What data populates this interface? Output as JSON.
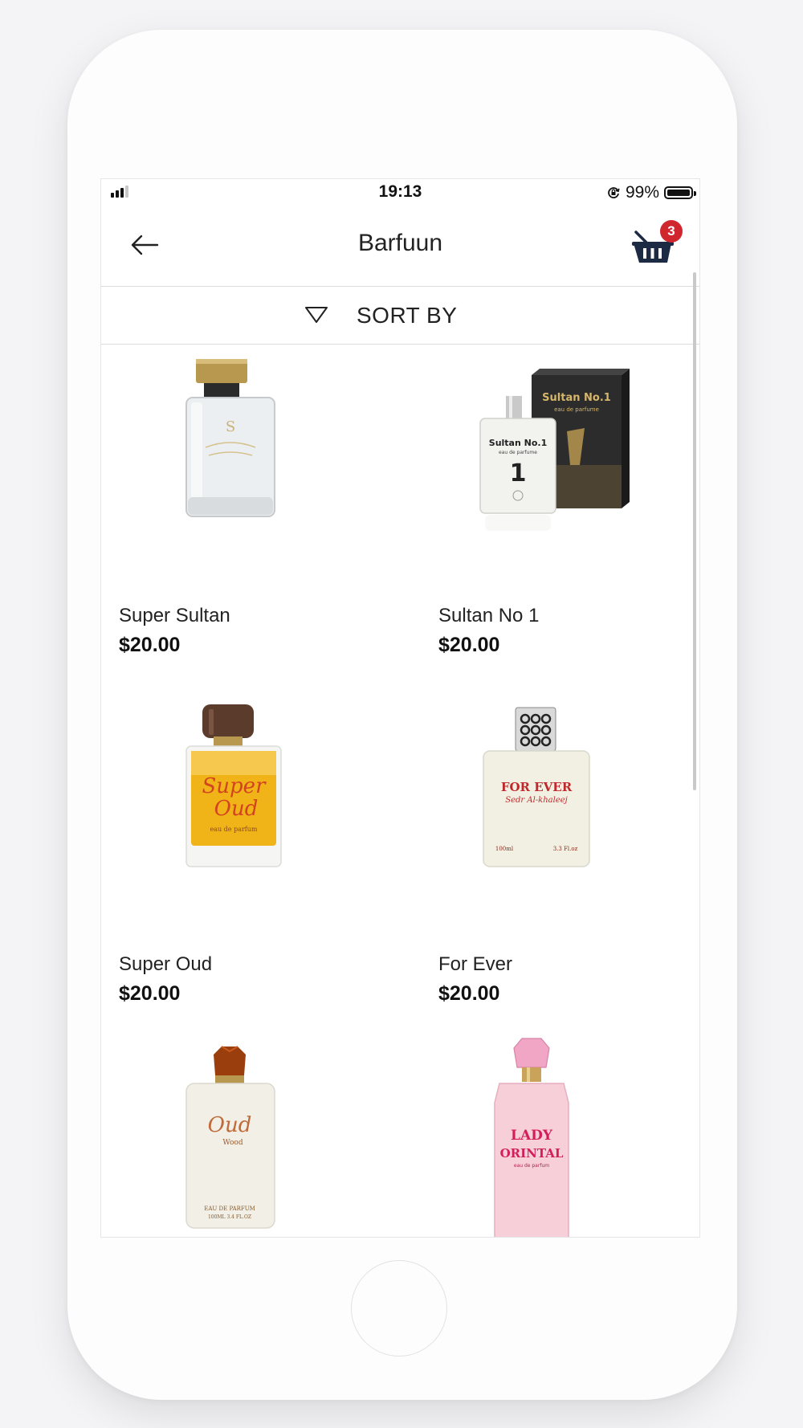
{
  "status_bar": {
    "time": "19:13",
    "battery_percent": "99%",
    "battery_level": 0.99,
    "signal_bars": 3
  },
  "header": {
    "title": "Barfuun",
    "back_icon": "arrow-left-icon",
    "cart_icon": "basket-icon",
    "cart_count": "3",
    "badge_color": "#d0262d"
  },
  "sort": {
    "label": "SORT BY",
    "icon": "triangle-down-icon"
  },
  "products": [
    {
      "name": "Super Sultan",
      "price": "$20.00"
    },
    {
      "name": "Sultan No 1",
      "price": "$20.00"
    },
    {
      "name": "Super Oud",
      "price": "$20.00"
    },
    {
      "name": "For Ever",
      "price": "$20.00"
    },
    {
      "name": "",
      "price": ""
    },
    {
      "name": "",
      "price": ""
    }
  ],
  "image_labels": {
    "super_sultan": "S",
    "sultan_no1_box": "Sultan No.1",
    "sultan_no1_box_sub": "eau de parfume",
    "sultan_no1_bottle": "Sultan No.1",
    "sultan_no1_bottle_sub": "eau de parfume",
    "sultan_no1_number": "1",
    "super_oud_line1": "Super",
    "super_oud_line2": "Oud",
    "super_oud_sub": "eau de parfum",
    "for_ever_line1": "FOR EVER",
    "for_ever_line2": "Sedr Al-khaleej",
    "for_ever_ml": "100ml",
    "for_ever_oz": "3.3 Fl.oz",
    "oud_wood_line1": "Oud",
    "oud_wood_line2": "Wood",
    "oud_wood_sub": "EAU DE PARFUM",
    "oud_wood_ml": "100ML 3.4 FL.OZ",
    "lady_line1": "LADY",
    "lady_line2": "ORINTAL",
    "lady_sub": "eau de parfum"
  }
}
